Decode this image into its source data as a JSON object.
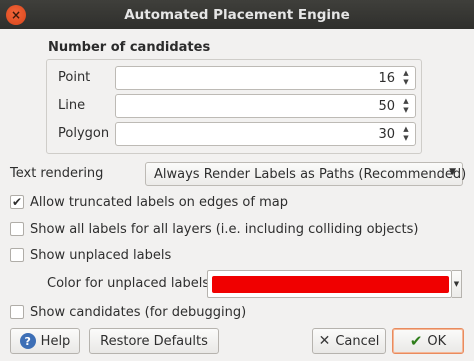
{
  "window": {
    "title": "Automated Placement Engine",
    "close_glyph": "×"
  },
  "candidates": {
    "title": "Number of candidates",
    "rows": [
      {
        "label": "Point",
        "value": "16"
      },
      {
        "label": "Line",
        "value": "50"
      },
      {
        "label": "Polygon",
        "value": "30"
      }
    ]
  },
  "text_rendering": {
    "label": "Text rendering",
    "selected": "Always Render Labels as Paths (Recommended)"
  },
  "options": [
    {
      "label": "Allow truncated labels on edges of map",
      "checked": true
    },
    {
      "label": "Show all labels for all layers (i.e. including colliding objects)",
      "checked": false
    },
    {
      "label": "Show unplaced labels",
      "checked": false
    },
    {
      "label": "Show candidates (for debugging)",
      "checked": false
    }
  ],
  "unplaced_color": {
    "label": "Color for unplaced labels",
    "color": "#f00000"
  },
  "buttons": {
    "help": "Help",
    "restore": "Restore Defaults",
    "cancel": "Cancel",
    "ok": "OK"
  },
  "icons": {
    "help": "help-icon",
    "cancel": "cancel-icon",
    "ok": "ok-check-icon",
    "spin": "spin-arrows-icon",
    "dropdown": "chevron-down-icon"
  }
}
